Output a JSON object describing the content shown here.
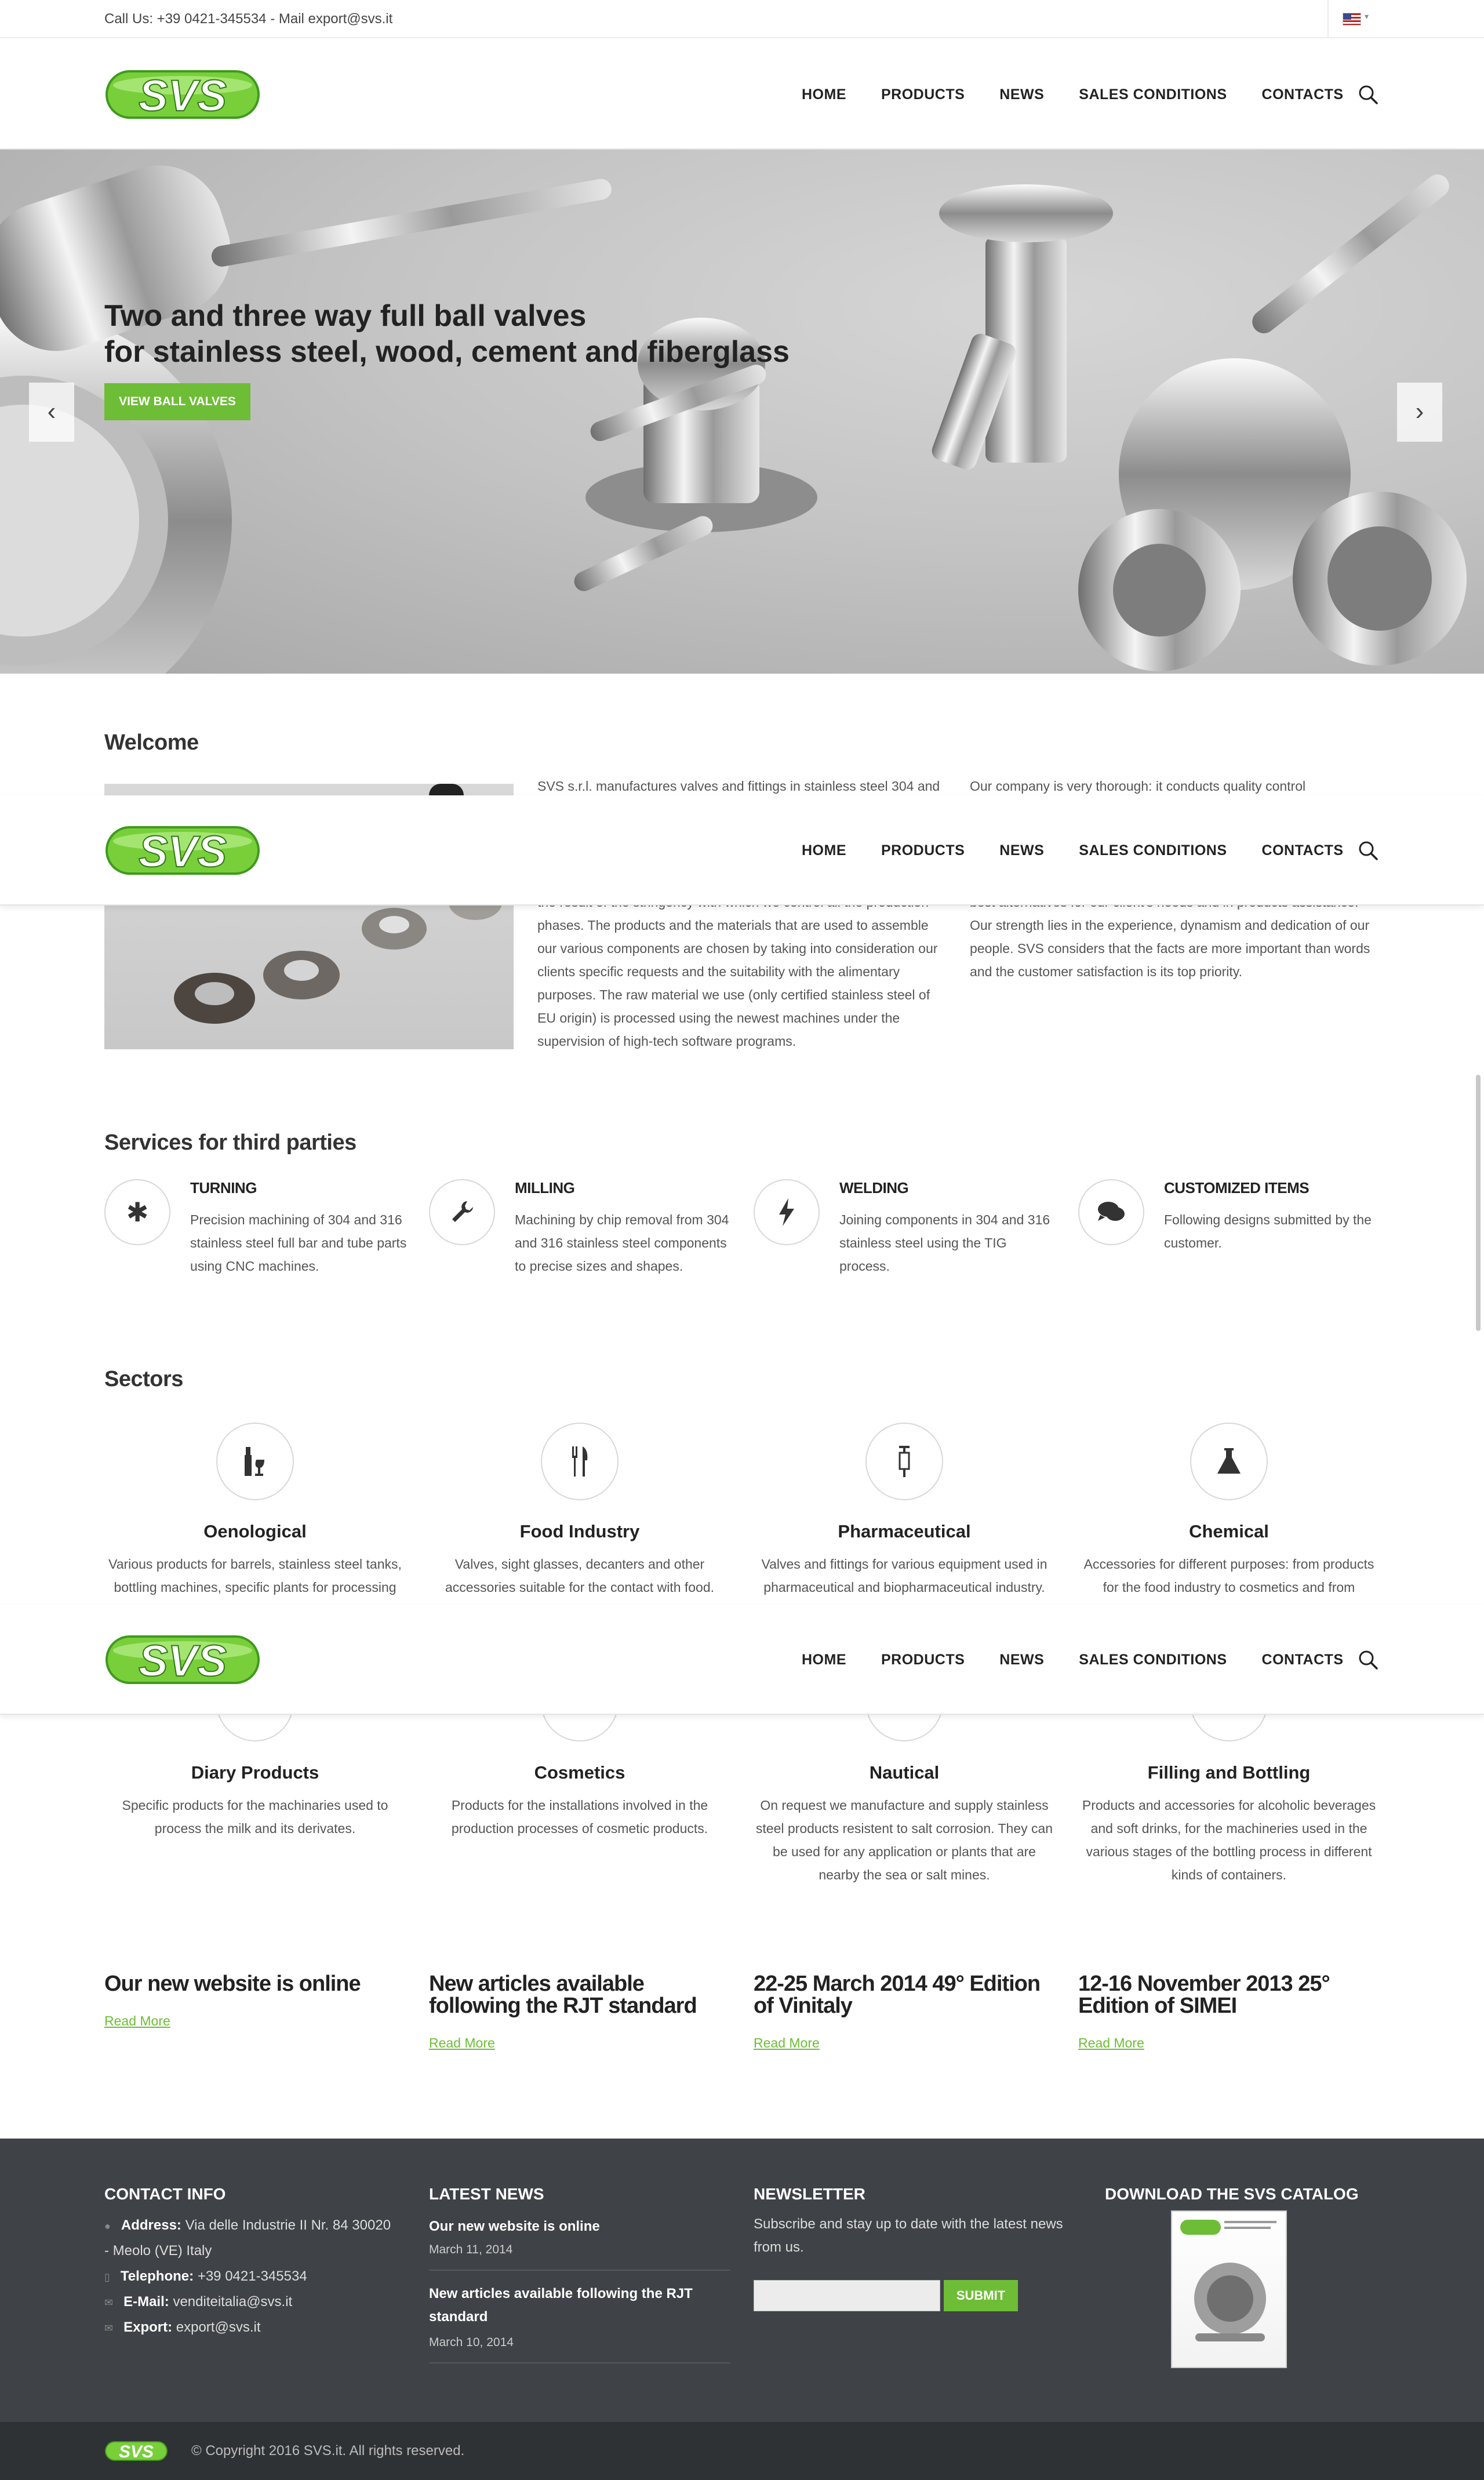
{
  "topbar": {
    "contact": "Call Us: +39 0421-345534 - Mail export@svs.it",
    "language_icon": "us-flag-icon"
  },
  "brand": {
    "logo_text": "SVS",
    "accent": "#6ebd36"
  },
  "nav": {
    "items": [
      "HOME",
      "PRODUCTS",
      "NEWS",
      "SALES CONDITIONS",
      "CONTACTS"
    ]
  },
  "hero": {
    "title_line1": "Two and three way full ball valves",
    "title_line2": "for stainless steel, wood, cement and fiberglass",
    "cta": "VIEW BALL VALVES",
    "prev_icon": "chevron-left-icon",
    "next_icon": "chevron-right-icon"
  },
  "welcome": {
    "title": "Welcome",
    "col1_top": "SVS s.r.l. manufactures valves and fittings in stainless steel 304 and 316 mostly destined for the food and beverage (especially",
    "col1_bottom": "the result of the stringency with which we control all the production phases. The products and the materials that are used to assemble our various components are chosen by taking into consideration our clients specific requests and the suitability with the alimentary purposes. The raw material we use (only certified stainless steel of EU origin) is processed using the newest machines under the supervision of high-tech software programs.",
    "col2_top": "Our company is very thorough: it conducts quality control procedures on the raw material and tests each component",
    "col2_bottom": "best alternatives for our client's needs and in products assistance. Our strength lies in the experience, dynamism and dedication of our people. SVS considers that the facts are more important than words and the customer satisfaction is its top priority."
  },
  "services": {
    "title": "Services for third parties",
    "items": [
      {
        "title": "TURNING",
        "text": "Precision machining of 304 and 316 stainless steel full bar and tube parts using CNC machines.",
        "icon": "asterisk-icon"
      },
      {
        "title": "MILLING",
        "text": "Machining by chip removal from 304 and 316 stainless steel components to precise sizes and shapes.",
        "icon": "wrench-icon"
      },
      {
        "title": "WELDING",
        "text": "Joining components in 304 and 316 stainless steel using the TIG process.",
        "icon": "bolt-icon"
      },
      {
        "title": "CUSTOMIZED ITEMS",
        "text": "Following designs submitted by the customer.",
        "icon": "chat-icon"
      }
    ]
  },
  "sectors": {
    "title": "Sectors",
    "items": [
      {
        "title": "Oenological",
        "text": "Various products for barrels, stainless steel tanks, bottling machines, specific plants for processing and filtration.",
        "icon": "wine-icon"
      },
      {
        "title": "Food Industry",
        "text": "Valves, sight glasses, decanters and other accessories suitable for the contact with food.",
        "icon": "cutlery-icon"
      },
      {
        "title": "Pharmaceutical",
        "text": "Valves and fittings for various equipment used in pharmaceutical and biopharmaceutical industry.",
        "icon": "syringe-icon"
      },
      {
        "title": "Chemical",
        "text": "Accessories for different purposes: from products for the food industry to cosmetics and from medicines to plastics.",
        "icon": "flask-icon"
      },
      {
        "title": "Diary Products",
        "text": "Specific products for the machinaries used to process the milk and its derivates.",
        "icon": "milk-icon"
      },
      {
        "title": "Cosmetics",
        "text": "Products for the installations involved in the production processes of cosmetic products.",
        "icon": "cosmetics-icon"
      },
      {
        "title": "Nautical",
        "text": "On request we manufacture and supply stainless steel products resistent to salt corrosion. They can be used for any application or plants that are nearby the sea or salt mines.",
        "icon": "anchor-icon"
      },
      {
        "title": "Filling and Bottling",
        "text": "Products and accessories for alcoholic beverages and soft drinks, for the machineries used in the various stages of the bottling process in different kinds of containers.",
        "icon": "bottle-icon"
      }
    ]
  },
  "news": {
    "read_more": "Read More",
    "items": [
      {
        "title": "Our new website is online"
      },
      {
        "title": "New articles available following the RJT standard"
      },
      {
        "title": "22-25 March 2014 49° Edition of Vinitaly"
      },
      {
        "title": "12-16 November 2013 25° Edition of SIMEI"
      }
    ]
  },
  "footer": {
    "contact": {
      "title": "CONTACT INFO",
      "address_label": "Address:",
      "address_value": "Via delle Industrie II Nr. 84 30020",
      "address_line2": "- Meolo (VE) Italy",
      "telephone_label": "Telephone:",
      "telephone_value": "+39 0421-345534",
      "email_label": "E-Mail:",
      "email_value": "venditeitalia@svs.it",
      "export_label": "Export:",
      "export_value": "export@svs.it"
    },
    "latest_news": {
      "title": "LATEST NEWS",
      "items": [
        {
          "title": "Our new website is online",
          "date": "March 11, 2014"
        },
        {
          "title": "New articles available following the RJT standard",
          "date": "March 10, 2014"
        }
      ]
    },
    "newsletter": {
      "title": "NEWSLETTER",
      "text": "Subscribe and stay up to date with the latest news from us.",
      "placeholder": "",
      "submit": "SUBMIT"
    },
    "catalog": {
      "title": "DOWNLOAD THE SVS CATALOG"
    },
    "copyright": "© Copyright 2016 SVS.it. All rights reserved."
  }
}
